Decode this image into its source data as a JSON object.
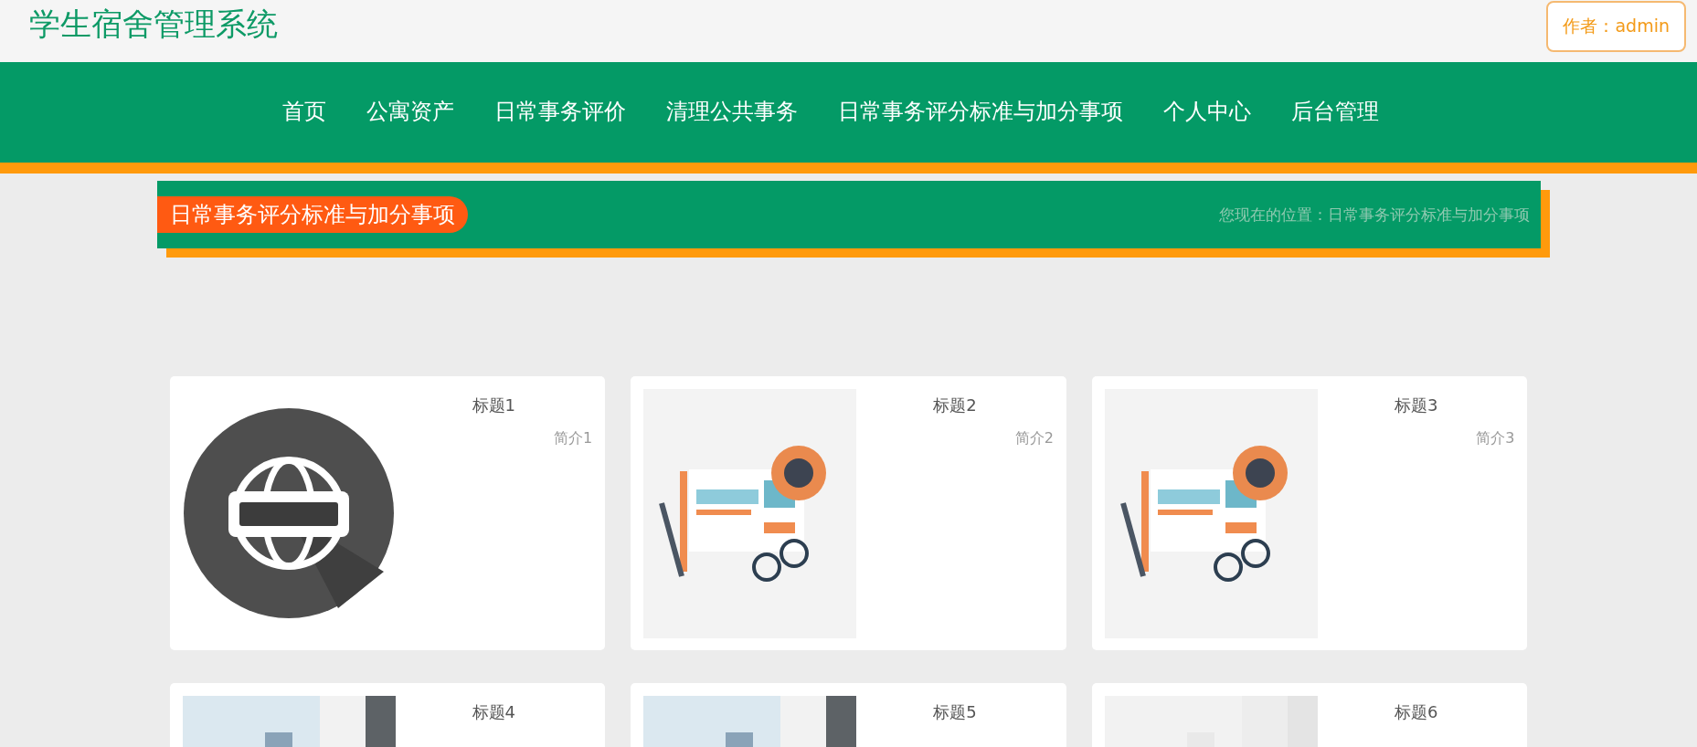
{
  "header": {
    "title": "学生宿舍管理系统",
    "author_button": "作者：admin"
  },
  "nav": [
    {
      "label": "首页"
    },
    {
      "label": "公寓资产"
    },
    {
      "label": "日常事务评价"
    },
    {
      "label": "清理公共事务"
    },
    {
      "label": "日常事务评分标准与加分事项"
    },
    {
      "label": "个人中心"
    },
    {
      "label": "后台管理"
    }
  ],
  "banner": {
    "heading": "日常事务评分标准与加分事项",
    "breadcrumb": "您现在的位置：日常事务评分标准与加分事项"
  },
  "cards": [
    {
      "title": "标题1",
      "intro": "简介1"
    },
    {
      "title": "标题2",
      "intro": "简介2"
    },
    {
      "title": "标题3",
      "intro": "简介3"
    },
    {
      "title": "标题4"
    },
    {
      "title": "标题5"
    },
    {
      "title": "标题6"
    }
  ]
}
